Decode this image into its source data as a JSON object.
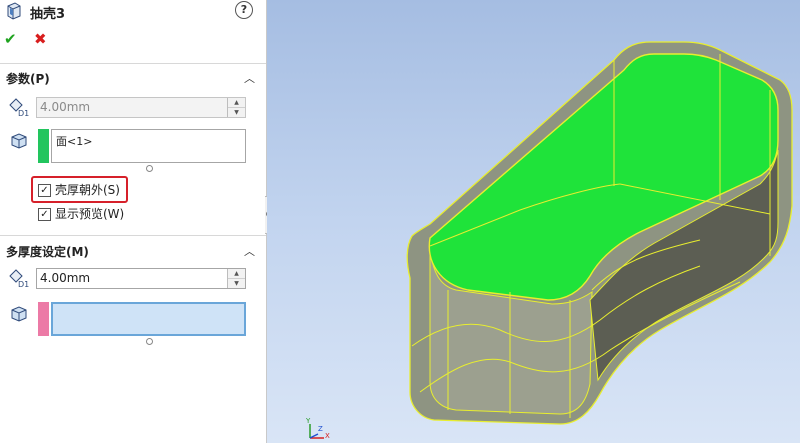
{
  "feature": {
    "title": "抽壳3",
    "help_label": "?"
  },
  "actions": {
    "ok": "✔",
    "cancel": "✖"
  },
  "params": {
    "title": "参数(P)",
    "thickness": "4.00mm",
    "faces": [
      "面<1>"
    ],
    "faces_color": "#22c55e",
    "shell_outward": {
      "label": "壳厚朝外(S)",
      "checked": true
    },
    "show_preview": {
      "label": "显示预览(W)",
      "checked": true
    }
  },
  "multi": {
    "title": "多厚度设定(M)",
    "thickness": "4.00mm",
    "faces_color": "#ec7aa6"
  },
  "triad": {
    "x": "X",
    "y": "Y",
    "z": "Z"
  },
  "colors": {
    "highlight": "#d6202a",
    "model_face": "#1fe33a",
    "edge": "#e8ee2f",
    "background": "#b4c9ea"
  }
}
